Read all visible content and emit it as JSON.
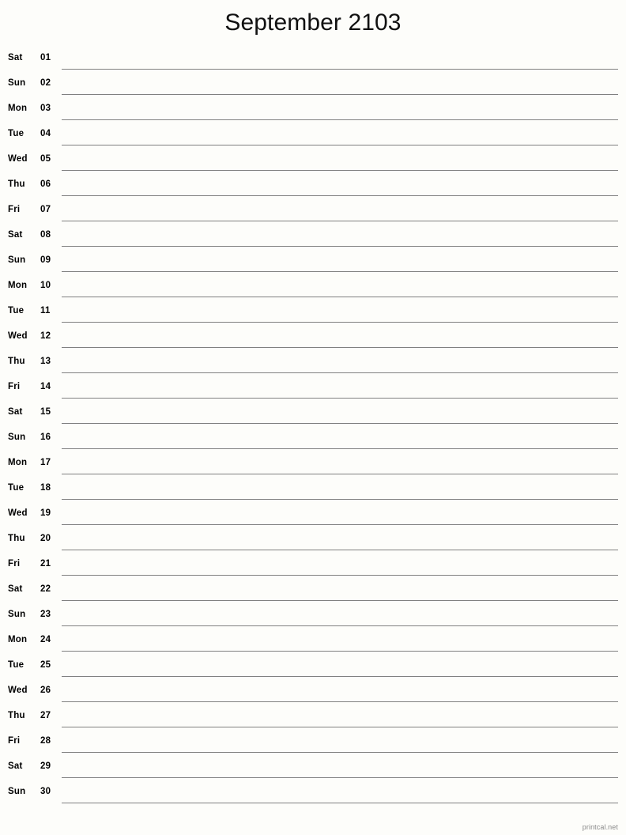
{
  "header": {
    "title": "September 2103",
    "month_name": "September",
    "year": "2103"
  },
  "colors": {
    "background": "#fdfdfa",
    "text": "#000000",
    "title_text": "#111111",
    "rule_line": "#808080",
    "footer_text": "#8a8a8a"
  },
  "days": [
    {
      "weekday": "Sat",
      "number": "01"
    },
    {
      "weekday": "Sun",
      "number": "02"
    },
    {
      "weekday": "Mon",
      "number": "03"
    },
    {
      "weekday": "Tue",
      "number": "04"
    },
    {
      "weekday": "Wed",
      "number": "05"
    },
    {
      "weekday": "Thu",
      "number": "06"
    },
    {
      "weekday": "Fri",
      "number": "07"
    },
    {
      "weekday": "Sat",
      "number": "08"
    },
    {
      "weekday": "Sun",
      "number": "09"
    },
    {
      "weekday": "Mon",
      "number": "10"
    },
    {
      "weekday": "Tue",
      "number": "11"
    },
    {
      "weekday": "Wed",
      "number": "12"
    },
    {
      "weekday": "Thu",
      "number": "13"
    },
    {
      "weekday": "Fri",
      "number": "14"
    },
    {
      "weekday": "Sat",
      "number": "15"
    },
    {
      "weekday": "Sun",
      "number": "16"
    },
    {
      "weekday": "Mon",
      "number": "17"
    },
    {
      "weekday": "Tue",
      "number": "18"
    },
    {
      "weekday": "Wed",
      "number": "19"
    },
    {
      "weekday": "Thu",
      "number": "20"
    },
    {
      "weekday": "Fri",
      "number": "21"
    },
    {
      "weekday": "Sat",
      "number": "22"
    },
    {
      "weekday": "Sun",
      "number": "23"
    },
    {
      "weekday": "Mon",
      "number": "24"
    },
    {
      "weekday": "Tue",
      "number": "25"
    },
    {
      "weekday": "Wed",
      "number": "26"
    },
    {
      "weekday": "Thu",
      "number": "27"
    },
    {
      "weekday": "Fri",
      "number": "28"
    },
    {
      "weekday": "Sat",
      "number": "29"
    },
    {
      "weekday": "Sun",
      "number": "30"
    }
  ],
  "footer": {
    "site": "printcal.net"
  }
}
